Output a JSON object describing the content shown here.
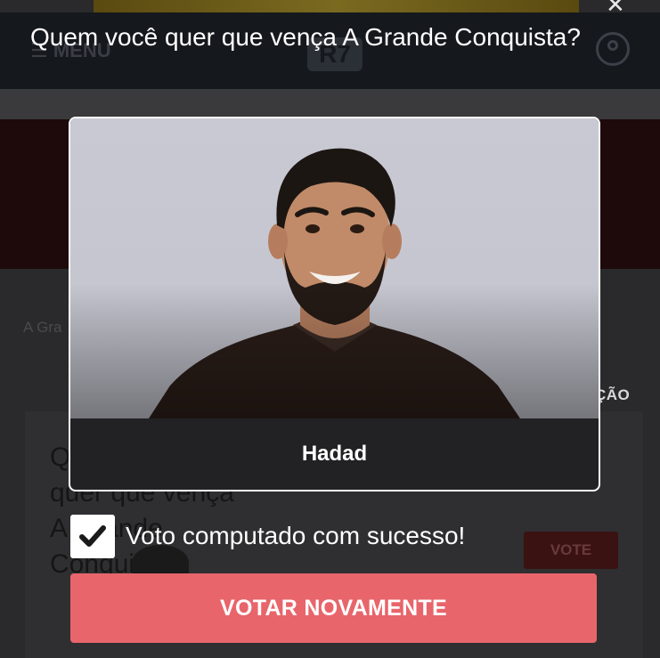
{
  "background": {
    "menu_label": "MENU",
    "logo_text": "R7",
    "breadcrumb": "A Gra",
    "tab_text": "ÇÃO",
    "card_title": "Quem você quer que vença A Grande Conquista?",
    "vote_label": "VOTE"
  },
  "poll": {
    "question": "Quem você quer que vença A Grande Conquista?",
    "candidate": {
      "name": "Hadad",
      "photo": "candidate-portrait"
    },
    "confirmation": {
      "checked": true,
      "text": "Voto computado com sucesso!"
    },
    "vote_again_label": "VOTAR NOVAMENTE"
  },
  "colors": {
    "accent": "#e8656b",
    "header": "#15181d",
    "card_bg": "#222224"
  }
}
